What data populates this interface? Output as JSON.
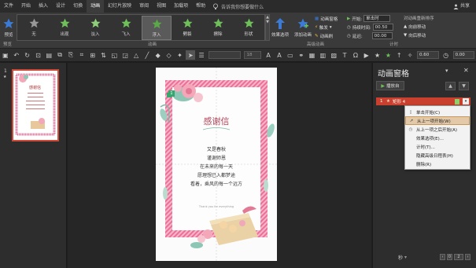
{
  "menubar": {
    "items": [
      "文件",
      "开始",
      "插入",
      "设计",
      "切换",
      "动画",
      "幻灯片放映",
      "审阅",
      "视图",
      "加载项",
      "帮助"
    ],
    "active_index": 5,
    "tell_me": "告诉我你想要做什么",
    "share": "共享"
  },
  "ribbon": {
    "preview": "预览",
    "effects": [
      "无",
      "出现",
      "淡入",
      "飞入",
      "浮入",
      "劈裂",
      "擦除",
      "形状"
    ],
    "selected_effect": 4,
    "effect_options": "效果选项",
    "add_animation": "添加动画",
    "animation_pane": "动画窗格",
    "trigger": "触发",
    "animation_painter": "动画刷",
    "start_label": "开始:",
    "start_value": "单击时",
    "duration_label": "持续时间:",
    "duration_value": "00.50",
    "delay_label": "延迟:",
    "delay_value": "00.00",
    "reorder": "对动画重新排序",
    "move_earlier": "向前移动",
    "move_later": "向后移动",
    "group_preview": "预览",
    "group_animation": "动画",
    "group_advanced": "高级动画",
    "group_timing": "计时"
  },
  "toolbar": {
    "font_size": "18",
    "value1": "0.60",
    "value2": "0.00"
  },
  "thumbs": {
    "number": "1",
    "star": "★"
  },
  "slide": {
    "title": "感谢信",
    "lines": [
      "又是春秋",
      "谨谢师恩",
      "在未来的每一天",
      "愿理想已入都梦途",
      "看着，乘风的每一个远方"
    ],
    "small": "Thank you for everything",
    "tag": "1",
    "thumb_title": "感谢信"
  },
  "pane": {
    "title": "动画窗格",
    "play": "播放自",
    "item_num": "1",
    "item_name": "矩形 4",
    "menu": [
      "单击开始(C)",
      "从上一项开始(W)",
      "从上一项之后开始(A)",
      "效果选项(E)...",
      "计时(T)...",
      "隐藏高级日程表(H)",
      "删除(R)"
    ],
    "highlight_index": 1,
    "footer_unit": "秒",
    "footer_value": "2"
  },
  "colors": {
    "accent": "#c9412e",
    "star": "#3b7bd5",
    "pink": "#ec6f9a"
  }
}
